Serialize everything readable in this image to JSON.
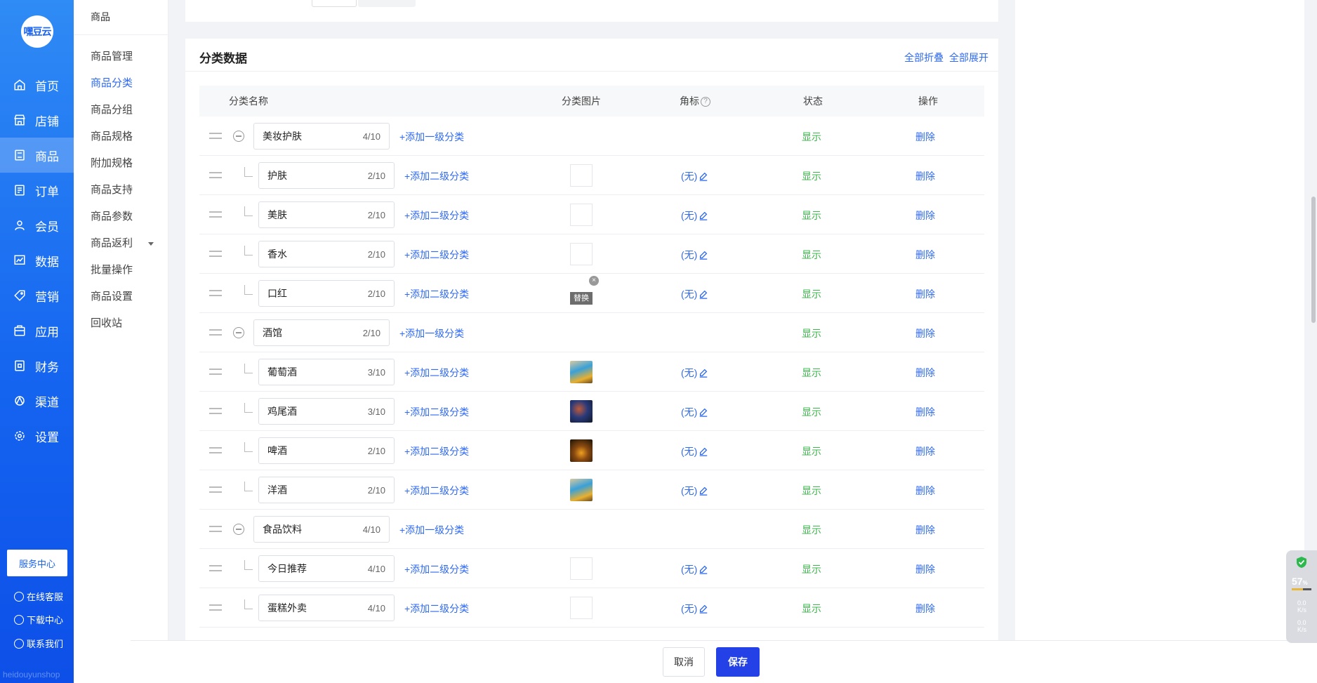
{
  "sidebar": {
    "logo_text": "嘿豆云",
    "items": [
      {
        "label": "首页",
        "icon": "home-icon"
      },
      {
        "label": "店铺",
        "icon": "shop-icon"
      },
      {
        "label": "商品",
        "icon": "goods-icon",
        "active": true
      },
      {
        "label": "订单",
        "icon": "order-icon"
      },
      {
        "label": "会员",
        "icon": "member-icon"
      },
      {
        "label": "数据",
        "icon": "chart-icon"
      },
      {
        "label": "营销",
        "icon": "tag-icon"
      },
      {
        "label": "应用",
        "icon": "app-icon"
      },
      {
        "label": "财务",
        "icon": "finance-icon"
      },
      {
        "label": "渠道",
        "icon": "channel-icon"
      },
      {
        "label": "设置",
        "icon": "gear-icon"
      }
    ],
    "service_center": "服务中心",
    "links": [
      "在线客服",
      "下载中心",
      "联系我们"
    ],
    "brand": "heidouyunshop"
  },
  "subsidebar": {
    "title": "商品",
    "items": [
      "商品管理",
      "商品分类",
      "商品分组",
      "商品规格",
      "附加规格",
      "商品支持",
      "商品参数",
      "商品返利",
      "批量操作",
      "商品设置",
      "回收站"
    ],
    "active_index": 1
  },
  "card": {
    "title": "分类数据",
    "collapse_all": "全部折叠",
    "expand_all": "全部展开"
  },
  "table": {
    "headers": {
      "name": "分类名称",
      "image": "分类图片",
      "badge": "角标",
      "help": "?",
      "status": "状态",
      "action": "操作"
    },
    "rows": [
      {
        "level": 1,
        "name": "美妆护肤",
        "count": "4/10",
        "add": "+添加一级分类",
        "image": "none",
        "badge": "",
        "status": "显示",
        "action": "删除"
      },
      {
        "level": 2,
        "name": "护肤",
        "count": "2/10",
        "add": "+添加二级分类",
        "image": "empty",
        "badge": "(无)",
        "status": "显示",
        "action": "删除"
      },
      {
        "level": 2,
        "name": "美肤",
        "count": "2/10",
        "add": "+添加二级分类",
        "image": "empty",
        "badge": "(无)",
        "status": "显示",
        "action": "删除"
      },
      {
        "level": 2,
        "name": "香水",
        "count": "2/10",
        "add": "+添加二级分类",
        "image": "empty",
        "badge": "(无)",
        "status": "显示",
        "action": "删除"
      },
      {
        "level": 2,
        "name": "口红",
        "count": "2/10",
        "add": "+添加二级分类",
        "image": "replace",
        "replace_label": "替换",
        "badge": "(无)",
        "status": "显示",
        "action": "删除"
      },
      {
        "level": 1,
        "name": "酒馆",
        "count": "2/10",
        "add": "+添加一级分类",
        "image": "none",
        "badge": "",
        "status": "显示",
        "action": "删除"
      },
      {
        "level": 2,
        "name": "葡萄酒",
        "count": "3/10",
        "add": "+添加二级分类",
        "image": "photo-cocktail",
        "badge": "(无)",
        "status": "显示",
        "action": "删除"
      },
      {
        "level": 2,
        "name": "鸡尾酒",
        "count": "3/10",
        "add": "+添加二级分类",
        "image": "photo-night",
        "badge": "(无)",
        "status": "显示",
        "action": "删除"
      },
      {
        "level": 2,
        "name": "啤酒",
        "count": "2/10",
        "add": "+添加二级分类",
        "image": "photo-beer",
        "badge": "(无)",
        "status": "显示",
        "action": "删除"
      },
      {
        "level": 2,
        "name": "洋酒",
        "count": "2/10",
        "add": "+添加二级分类",
        "image": "photo-cocktail",
        "badge": "(无)",
        "status": "显示",
        "action": "删除"
      },
      {
        "level": 1,
        "name": "食品饮料",
        "count": "4/10",
        "add": "+添加一级分类",
        "image": "none",
        "badge": "",
        "status": "显示",
        "action": "删除"
      },
      {
        "level": 2,
        "name": "今日推荐",
        "count": "4/10",
        "add": "+添加二级分类",
        "image": "empty",
        "badge": "(无)",
        "status": "显示",
        "action": "删除"
      },
      {
        "level": 2,
        "name": "蛋糕外卖",
        "count": "4/10",
        "add": "+添加二级分类",
        "image": "empty",
        "badge": "(无)",
        "status": "显示",
        "action": "删除"
      }
    ]
  },
  "footer": {
    "cancel": "取消",
    "save": "保存"
  },
  "monitor": {
    "percent": "57",
    "percent_unit": "%",
    "upload": "0.0",
    "download": "0.0",
    "unit": "K/s"
  },
  "colors": {
    "accent": "#2f6af0",
    "sidebar": "#1565f0",
    "status_green": "#3bb54a",
    "save_button": "#2341e6"
  }
}
